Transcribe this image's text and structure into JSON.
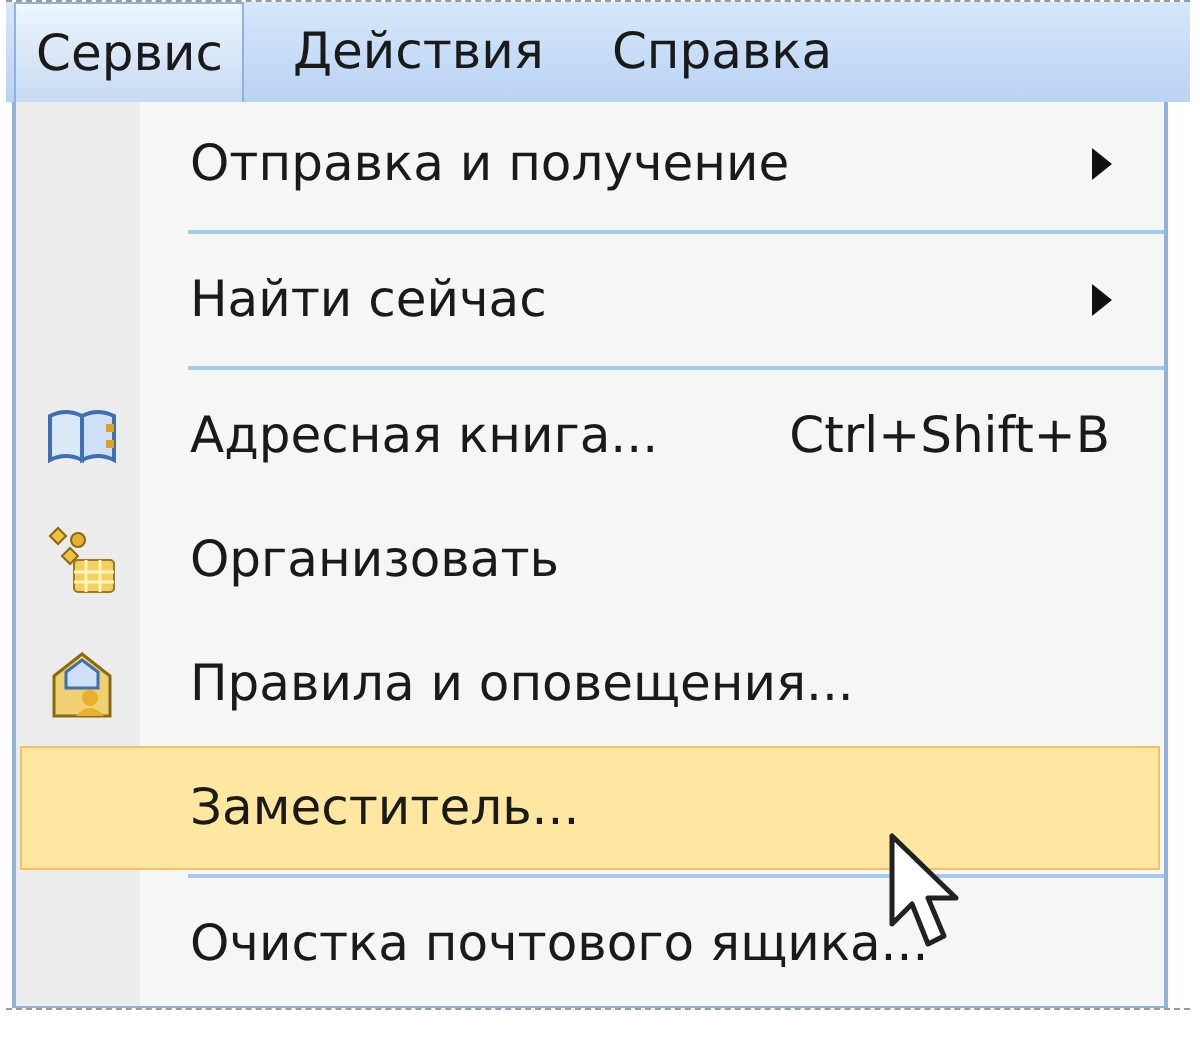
{
  "menubar": [
    {
      "label": "Сервис",
      "selected": true
    },
    {
      "label": "Действия",
      "selected": false
    },
    {
      "label": "Справка",
      "selected": false
    }
  ],
  "menu": [
    {
      "kind": "item",
      "label": "Отправка и получение",
      "submenu": true,
      "selected": false
    },
    {
      "kind": "separator"
    },
    {
      "kind": "item",
      "label": "Найти сейчас",
      "submenu": true,
      "selected": false
    },
    {
      "kind": "separator"
    },
    {
      "kind": "book",
      "label": "Адресная книга...",
      "shortcut": "Ctrl+Shift+B",
      "submenu": false,
      "selected": false
    },
    {
      "kind": "organize",
      "label": "Организовать",
      "submenu": false,
      "selected": false
    },
    {
      "kind": "rules",
      "label": "Правила и оповещения...",
      "submenu": false,
      "selected": false
    },
    {
      "kind": "item",
      "label": "Заместитель...",
      "submenu": false,
      "selected": true
    },
    {
      "kind": "separator"
    },
    {
      "kind": "item",
      "label": "Очистка почтового ящика...",
      "submenu": false,
      "selected": false
    }
  ]
}
